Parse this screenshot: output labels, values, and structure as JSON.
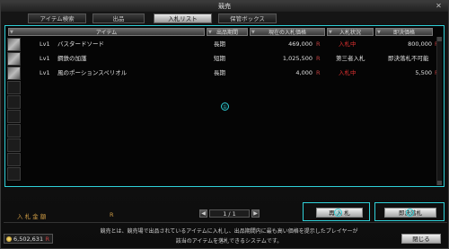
{
  "window": {
    "title": "競売",
    "close": "✕"
  },
  "tabs": [
    {
      "label": "アイテム検索"
    },
    {
      "label": "出品"
    },
    {
      "label": "入札リスト"
    },
    {
      "label": "保管ボックス"
    }
  ],
  "columns": {
    "item": "アイテム",
    "period": "出品期間",
    "current_bid": "現在の入札価格",
    "status": "入札状況",
    "buyout": "即決価格"
  },
  "rows": [
    {
      "level": "Lv1",
      "name": "バスタードソード",
      "period": "長期",
      "current_bid": "469,000",
      "bid_r": "R",
      "status": "入札中",
      "buyout": "800,000",
      "buyout_r": "R"
    },
    {
      "level": "Lv1",
      "name": "鋼鉄の加護",
      "period": "短期",
      "current_bid": "1,025,500",
      "bid_r": "R",
      "status": "第三者入札",
      "buyout": "即決落札不可能",
      "buyout_r": ""
    },
    {
      "level": "Lv1",
      "name": "風のポーションスペリオル",
      "period": "長期",
      "current_bid": "4,000",
      "bid_r": "R",
      "status": "入札中",
      "buyout": "5,500",
      "buyout_r": "R"
    }
  ],
  "annotations": {
    "one": "①",
    "two": "②",
    "three": "③"
  },
  "bid_amount": {
    "label": "入 札 金 額",
    "currency": "R"
  },
  "pager": {
    "text": "1 / 1",
    "prev": "◀",
    "next": "▶"
  },
  "buttons": {
    "rebid": "再 入 札",
    "buyout": "即決落札",
    "close": "閉じる"
  },
  "money": {
    "amount": "6,502,631",
    "currency": "R"
  },
  "info": {
    "line1": "競売とは、競売場で出品されているアイテムに入札し、出品期間内に最も高い価格を提示したプレイヤーが",
    "line2": "該当のアイテムを落札できるシステムです。"
  }
}
